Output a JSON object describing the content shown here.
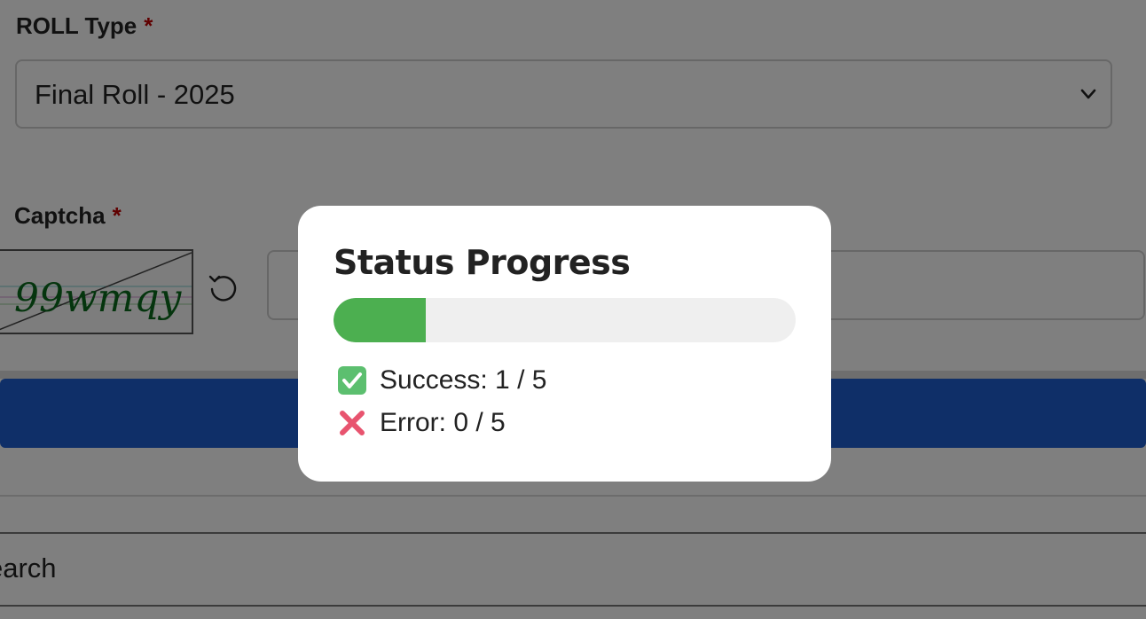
{
  "form": {
    "roll_type_label": "ROLL Type",
    "required_mark": "*",
    "roll_type_value": "Final Roll - 2025",
    "captcha_label": "Captcha",
    "captcha_text": "99wmqy",
    "search_text": "earch"
  },
  "modal": {
    "title": "Status Progress",
    "progress": {
      "completed": 1,
      "total": 5,
      "percent": 20
    },
    "success_label": "Success: 1 / 5",
    "error_label": "Error: 0 / 5"
  },
  "colors": {
    "progress_fill": "#4caf50",
    "progress_track": "#efefef",
    "primary_button": "#1f5fd0",
    "required_mark": "#c00000"
  },
  "icons": {
    "success": "check-mark-button-icon",
    "error": "cross-mark-icon",
    "select": "chevron-down-icon",
    "refresh": "refresh-icon"
  }
}
